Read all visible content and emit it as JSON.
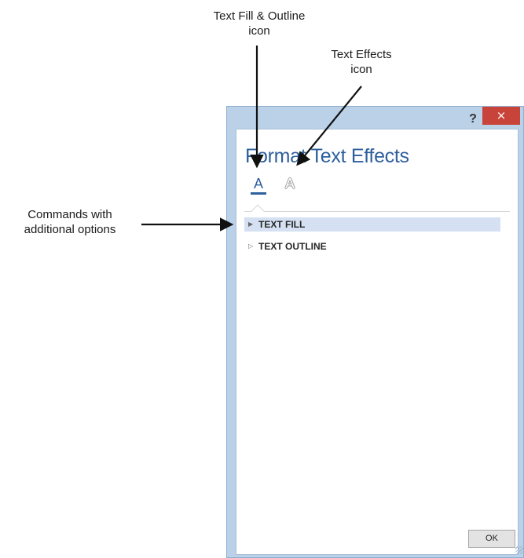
{
  "annotations": {
    "text_fill_outline": [
      "Text Fill & Outline",
      "icon"
    ],
    "text_effects": [
      "Text Effects",
      "icon"
    ],
    "commands": [
      "Commands with",
      "additional options"
    ]
  },
  "dialog": {
    "help_label": "?",
    "close_label": "×",
    "panel_title": "Format Text Effects",
    "tabs": [
      {
        "name": "Text Fill & Outline",
        "glyph": "A",
        "selected": true
      },
      {
        "name": "Text Effects",
        "glyph": "A",
        "selected": false
      }
    ],
    "sections": [
      {
        "label": "TEXT FILL",
        "caret": "▶",
        "selected": true
      },
      {
        "label": "TEXT OUTLINE",
        "caret": "▷",
        "selected": false
      }
    ],
    "ok_label": "OK"
  },
  "colors": {
    "accent": "#2e5f9e",
    "close": "#c8433a",
    "frame": "#bad1e8",
    "selected_row": "#d5e1f2"
  }
}
